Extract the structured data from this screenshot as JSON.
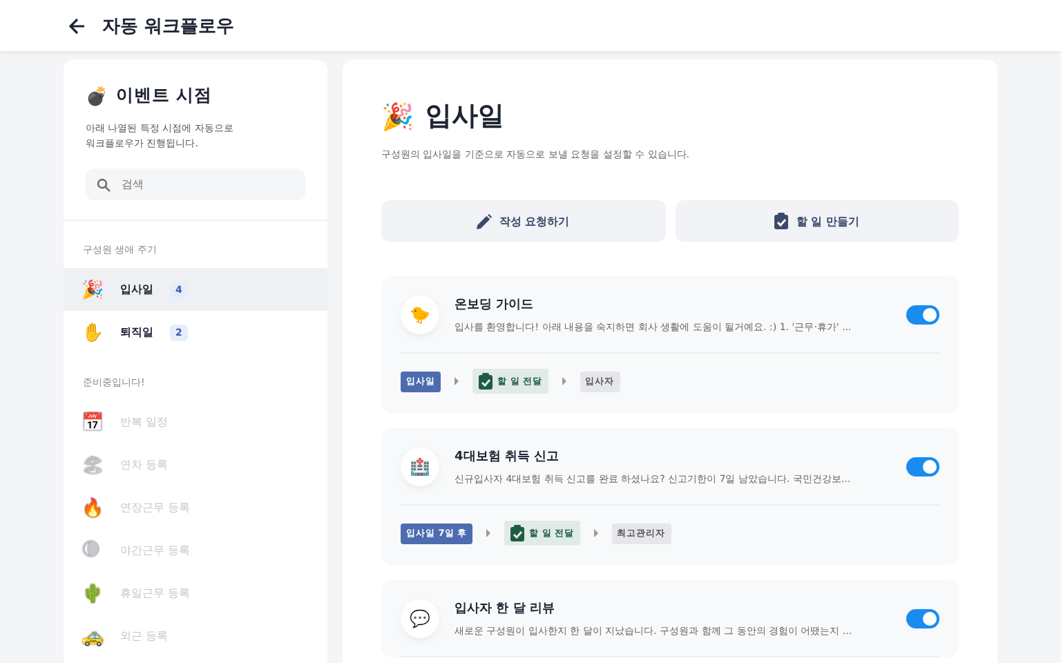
{
  "header": {
    "title": "자동 워크플로우"
  },
  "sidebar": {
    "icon": "💣",
    "title": "이벤트 시점",
    "description": "아래 나열된 특정 시점에 자동으로 워크플로우가 진행됩니다.",
    "search": {
      "placeholder": "검색"
    },
    "sections": [
      {
        "label": "구성원 생애 주기",
        "items": [
          {
            "icon": "🎉",
            "label": "입사일",
            "count": "4",
            "selected": true,
            "disabled": false
          },
          {
            "icon": "✋",
            "label": "퇴직일",
            "count": "2",
            "selected": false,
            "disabled": false
          }
        ]
      },
      {
        "label": "준비중입니다!",
        "items": [
          {
            "icon": "📅",
            "label": "반복 일정",
            "selected": false,
            "disabled": true
          },
          {
            "icon": "🏖",
            "label": "연차 등록",
            "selected": false,
            "disabled": true
          },
          {
            "icon": "🔥",
            "label": "연장근무 등록",
            "selected": false,
            "disabled": true
          },
          {
            "icon": "🌘",
            "label": "야간근무 등록",
            "selected": false,
            "disabled": true
          },
          {
            "icon": "🌵",
            "label": "휴일근무 등록",
            "selected": false,
            "disabled": true
          },
          {
            "icon": "🚕",
            "label": "외근 등록",
            "selected": false,
            "disabled": true
          }
        ]
      }
    ]
  },
  "main": {
    "icon": "🎉",
    "title": "입사일",
    "description": "구성원의 입사일을 기준으로 자동으로 보낼 요청을 설정할 수 있습니다.",
    "actions": [
      {
        "kind": "pencil",
        "label": "작성 요청하기"
      },
      {
        "kind": "clipboard",
        "label": "할 일 만들기"
      }
    ],
    "workflows": [
      {
        "icon": "🐤",
        "title": "온보딩 가이드",
        "description": "입사를 환영합니다! 아래 내용을 숙지하면 회사 생활에 도움이 될거예요. :) 1. '근무·휴가' ...",
        "on": true,
        "steps": [
          {
            "kind": "trigger",
            "label": "입사일"
          },
          {
            "kind": "action",
            "label": "할 일 전달"
          },
          {
            "kind": "target",
            "label": "입사자"
          }
        ]
      },
      {
        "icon": "🏥",
        "title": "4대보험 취득 신고",
        "description": "신규입사자 4대보험 취득 신고를 완료 하셨나요? 신고기한이 7일 남았습니다. 국민건강보...",
        "on": true,
        "steps": [
          {
            "kind": "trigger",
            "label": "입사일 7일 후"
          },
          {
            "kind": "action",
            "label": "할 일 전달"
          },
          {
            "kind": "target",
            "label": "최고관리자"
          }
        ]
      },
      {
        "icon": "💬",
        "title": "입사자 한 달 리뷰",
        "description": "새로운 구성원이 입사한지 한 달이 지났습니다. 구성원과 함께 그 동안의 경험이 어땠는지 ...",
        "on": true
      }
    ]
  }
}
